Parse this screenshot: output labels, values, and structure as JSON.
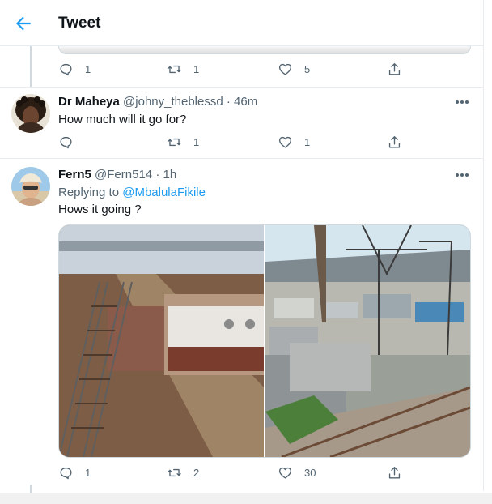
{
  "header": {
    "title": "Tweet"
  },
  "tweets": [
    {
      "actions": {
        "replies": "1",
        "retweets": "1",
        "likes": "5"
      }
    },
    {
      "name": "Dr Maheya",
      "handle": "@johny_theblessd",
      "separator": "·",
      "time": "46m",
      "text": "How much will it go for?",
      "actions": {
        "replies": "",
        "retweets": "1",
        "likes": "1"
      }
    },
    {
      "name": "Fern5",
      "handle": "@Fern514",
      "separator": "·",
      "time": "1h",
      "replying_prefix": "Replying to ",
      "replying_to": "@MbalulaFikile",
      "text": "Hows it going ?",
      "actions": {
        "replies": "1",
        "retweets": "2",
        "likes": "30"
      }
    }
  ],
  "icons": {
    "back": "arrow-left-icon",
    "reply": "speech-bubble-icon",
    "retweet": "retweet-icon",
    "like": "heart-icon",
    "share": "share-upload-icon",
    "more": "more-dots-icon"
  },
  "colors": {
    "accent": "#1d9bf0",
    "text": "#0f1419",
    "muted": "#536471",
    "border": "#e6ecf0"
  }
}
